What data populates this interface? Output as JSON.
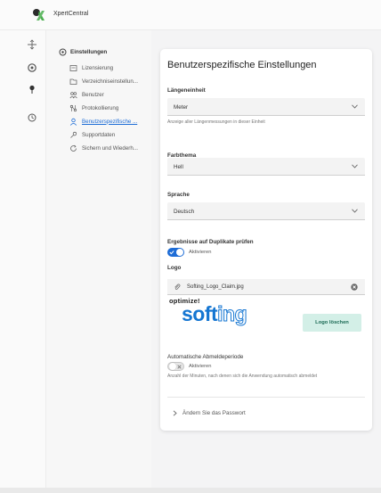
{
  "app": {
    "title": "XpertCentral"
  },
  "nav": {
    "root_label": "Einstellungen",
    "items": [
      {
        "label": "Lizensierung",
        "icon": "license-icon"
      },
      {
        "label": "Verzeichniseinstellun...",
        "icon": "folder-settings-icon"
      },
      {
        "label": "Benutzer",
        "icon": "users-icon"
      },
      {
        "label": "Protokollierung",
        "icon": "log-icon"
      },
      {
        "label": "Benutzerspezifische ...",
        "icon": "user-settings-icon",
        "active": true
      },
      {
        "label": "Supportdaten",
        "icon": "support-icon"
      },
      {
        "label": "Sichern und Wiederh...",
        "icon": "backup-icon"
      }
    ]
  },
  "page": {
    "heading": "Benutzerspezifische Einstellungen",
    "length_unit": {
      "label": "Längeneinheit",
      "value": "Meter",
      "hint": "Anzeige aller Längenmessungen in dieser Einheit"
    },
    "color_theme": {
      "label": "Farbthema",
      "value": "Hell"
    },
    "language": {
      "label": "Sprache",
      "value": "Deutsch"
    },
    "duplicates": {
      "label": "Ergebnisse auf Duplikate prüfen",
      "toggle_label": "Aktivieren",
      "enabled": true
    },
    "logo": {
      "label": "Logo",
      "filename": "Softing_Logo_Claim.jpg",
      "claim_text": "optimize!",
      "brand_prefix": "soft",
      "brand_suffix": "ing",
      "delete_label": "Logo löschen"
    },
    "auto_logout": {
      "label": "Automatische Abmeldeperiode",
      "toggle_label": "Aktivieren",
      "enabled": false,
      "hint": "Anzahl der Minuten, nach denen sich die Anwendung automatisch abmeldet"
    },
    "change_password": {
      "label": "Ändern Sie das Passwort"
    }
  },
  "colors": {
    "accent": "#1d6cd6",
    "brand_blue": "#1576d2",
    "delete_bg": "#d3efe7"
  }
}
